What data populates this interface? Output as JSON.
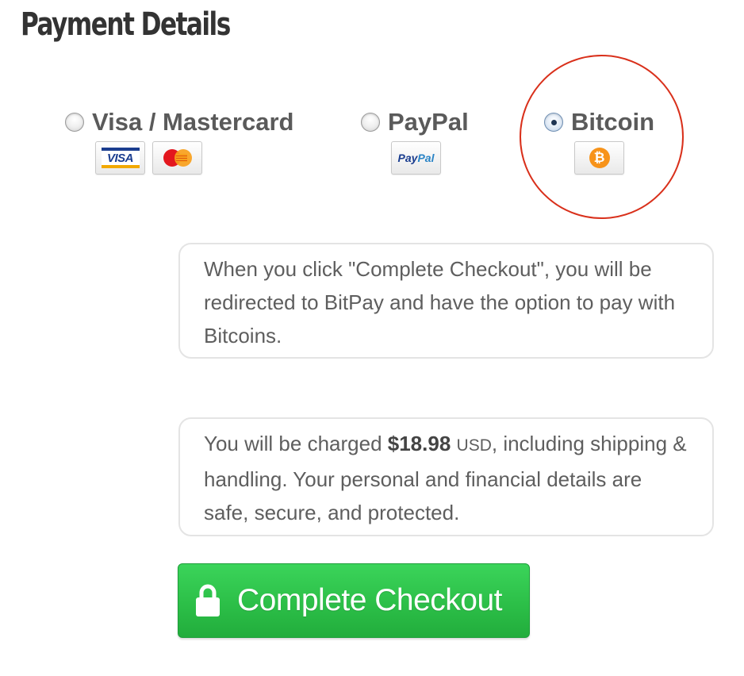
{
  "page": {
    "title": "Payment Details"
  },
  "payment_options": [
    {
      "label": "Visa / Mastercard",
      "selected": false,
      "logos": [
        {
          "icon": "visa-logo-icon",
          "text": "VISA"
        },
        {
          "icon": "mastercard-logo-icon"
        }
      ]
    },
    {
      "label": "PayPal",
      "selected": false,
      "logos": [
        {
          "icon": "paypal-logo-icon",
          "text_a": "Pay",
          "text_b": "Pal"
        }
      ]
    },
    {
      "label": "Bitcoin",
      "selected": true,
      "logos": [
        {
          "icon": "bitcoin-logo-icon",
          "text": "₿"
        }
      ]
    }
  ],
  "notices": {
    "redirect": "When you click \"Complete Checkout\", you will be redirected to BitPay and have the option to pay with Bitcoins.",
    "charge": {
      "prefix": "You will be charged ",
      "amount": "$18.98",
      "currency": "USD",
      "suffix": ", including shipping & handling. Your personal and financial details are safe, secure, and protected."
    }
  },
  "checkout": {
    "label": "Complete Checkout",
    "icon": "lock-icon"
  },
  "colors": {
    "button_green": "#2cbf48",
    "highlight_red": "#d9301b",
    "bitcoin_orange": "#f7931a",
    "visa_blue": "#1a3d8f"
  }
}
